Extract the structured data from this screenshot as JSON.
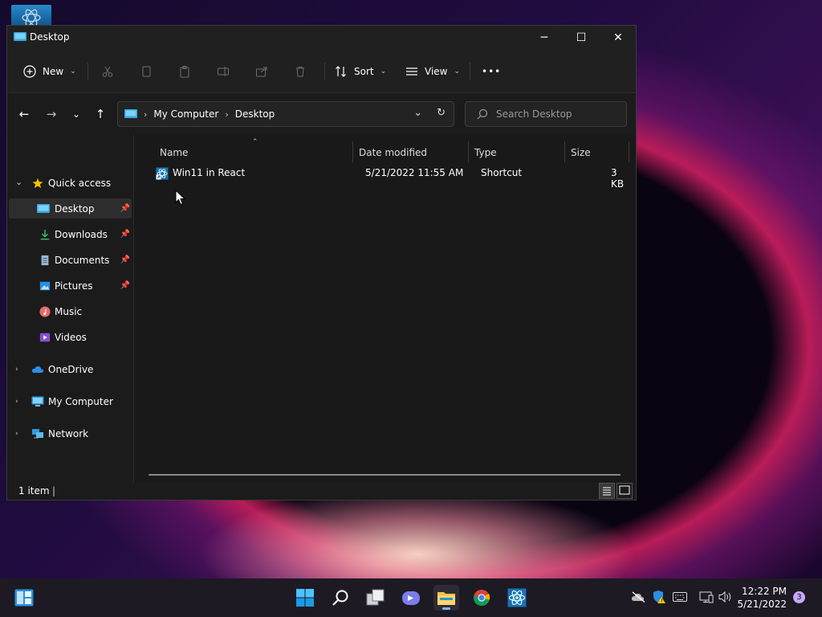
{
  "window": {
    "title": "Desktop",
    "minimize_glyph": "─",
    "maximize_glyph": "☐",
    "close_glyph": "✕"
  },
  "toolbar": {
    "new_label": "New",
    "sort_label": "Sort",
    "view_label": "View",
    "more_glyph": "•••",
    "chevron_glyph": "⌄"
  },
  "nav": {
    "back_glyph": "←",
    "forward_glyph": "→",
    "recent_glyph": "⌄",
    "up_glyph": "↑"
  },
  "address": {
    "segments": [
      "My Computer",
      "Desktop"
    ],
    "separator": "›",
    "dropdown_glyph": "⌄",
    "refresh_glyph": "↻"
  },
  "search": {
    "placeholder": "Search Desktop"
  },
  "sidebar": {
    "quick_access": "Quick access",
    "items": [
      {
        "label": "Desktop",
        "pinned": true,
        "icon": "desktop-icon"
      },
      {
        "label": "Downloads",
        "pinned": true,
        "icon": "download-icon"
      },
      {
        "label": "Documents",
        "pinned": true,
        "icon": "document-icon"
      },
      {
        "label": "Pictures",
        "pinned": true,
        "icon": "picture-icon"
      },
      {
        "label": "Music",
        "pinned": false,
        "icon": "music-icon"
      },
      {
        "label": "Videos",
        "pinned": false,
        "icon": "video-icon"
      }
    ],
    "onedrive": "OneDrive",
    "mycomputer": "My Computer",
    "network": "Network"
  },
  "columns": {
    "name": "Name",
    "date_modified": "Date modified",
    "type": "Type",
    "size": "Size"
  },
  "files": [
    {
      "name": "Win11 in React",
      "date_modified": "5/21/2022 11:55 AM",
      "type": "Shortcut",
      "size": "3 KB",
      "icon": "react-shortcut-icon"
    }
  ],
  "status": {
    "count": "1 item"
  },
  "taskbar": {
    "time": "12:22 PM",
    "date": "5/21/2022",
    "notification_count": "3"
  },
  "colors": {
    "accent": "#4cc2ff",
    "window_bg": "#191919",
    "titlebar_bg": "#202020",
    "taskbar_bg": "#1d1a24",
    "folder_yellow": "#f5c242",
    "star_yellow": "#f3c400"
  }
}
